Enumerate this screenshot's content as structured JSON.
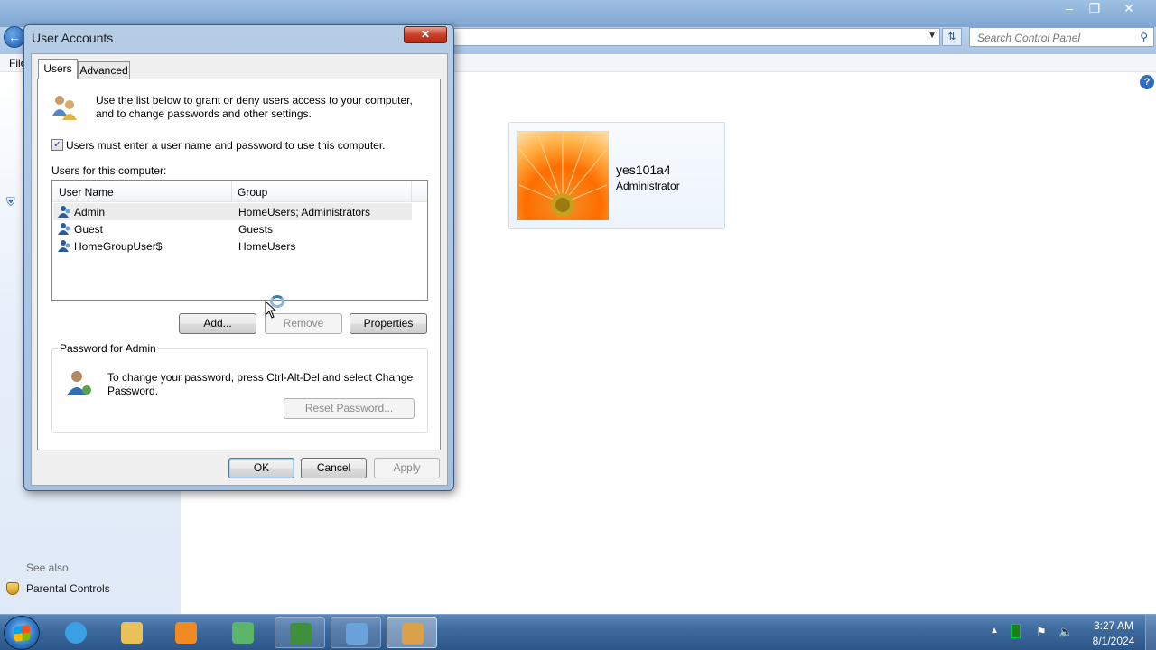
{
  "background_window": {
    "search_placeholder": "Search Control Panel",
    "menu_file": "File",
    "left_pane": {
      "see_also": "See also",
      "parental_controls": "Parental Controls"
    },
    "user_tile": {
      "name": "yes101a4",
      "role": "Administrator"
    }
  },
  "dialog": {
    "title": "User Accounts",
    "tabs": [
      {
        "label": "Users",
        "selected": true
      },
      {
        "label": "Advanced",
        "selected": false
      }
    ],
    "intro_text": "Use the list below to grant or deny users access to your computer, and to change passwords and other settings.",
    "must_enter_checkbox": {
      "label": "Users must enter a user name and password to use this computer.",
      "checked": true,
      "mark": "✓"
    },
    "users_for_label": "Users for this computer:",
    "columns": {
      "user_name": "User Name",
      "group": "Group"
    },
    "users": [
      {
        "name": "Admin",
        "group": "HomeUsers; Administrators",
        "selected": true
      },
      {
        "name": "Guest",
        "group": "Guests",
        "selected": false
      },
      {
        "name": "HomeGroupUser$",
        "group": "HomeUsers",
        "selected": false
      }
    ],
    "buttons": {
      "add": "Add...",
      "remove": "Remove",
      "properties": "Properties",
      "reset_password": "Reset Password...",
      "ok": "OK",
      "cancel": "Cancel",
      "apply": "Apply"
    },
    "password_group": {
      "title": "Password for Admin",
      "text": "To change your password, press Ctrl-Alt-Del and select Change Password."
    }
  },
  "taskbar": {
    "items": [
      {
        "icon": "internet-explorer-icon",
        "color": "#3aa0e6"
      },
      {
        "icon": "windows-explorer-icon",
        "color": "#e8c15a"
      },
      {
        "icon": "media-player-icon",
        "color": "#f08a24"
      },
      {
        "icon": "network-icon",
        "color": "#5bb56a"
      },
      {
        "icon": "terminal-icon",
        "color": "#3f8f3f"
      },
      {
        "icon": "control-panel-icon",
        "color": "#6aa2dc"
      },
      {
        "icon": "user-accounts-icon",
        "color": "#d9a24a"
      }
    ],
    "clock": {
      "time": "3:27 AM",
      "date": "8/1/2024"
    }
  }
}
